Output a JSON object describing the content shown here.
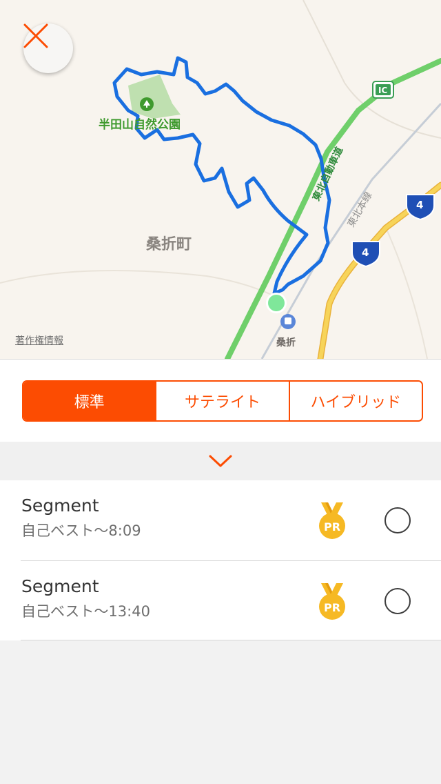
{
  "map": {
    "park_label": "半田山自然公園",
    "town_label": "桑折町",
    "station_label": "桑折",
    "copyright": "著作権情報",
    "expressway_label": "東北自動車道",
    "rail_label": "東北本線",
    "ic_badge": "IC",
    "route_shield_1": "4",
    "route_shield_2": "4",
    "route_color": "#1a6fe0",
    "start_marker_color": "#7fe79a"
  },
  "controls": {
    "map_types": [
      "標準",
      "サテライト",
      "ハイブリッド"
    ],
    "selected_map_type": "標準",
    "accent_color": "#fc4c02"
  },
  "segments": [
    {
      "name": "Segment",
      "best": "自己ベスト〜8:09",
      "badge": "PR",
      "selected": false
    },
    {
      "name": "Segment",
      "best": "自己ベスト〜13:40",
      "badge": "PR",
      "selected": false
    }
  ]
}
